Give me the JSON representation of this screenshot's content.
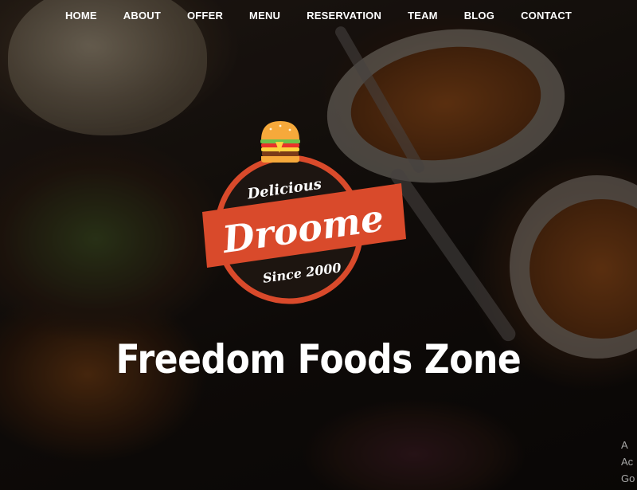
{
  "nav": {
    "items": [
      "HOME",
      "ABOUT",
      "OFFER",
      "MENU",
      "RESERVATION",
      "TEAM",
      "BLOG",
      "CONTACT"
    ]
  },
  "logo": {
    "tagline_top": "Delicious",
    "brand": "Droome",
    "tagline_bottom": "Since 2000",
    "icon": "burger-icon"
  },
  "hero": {
    "title": "Freedom Foods Zone"
  },
  "watermark": {
    "lines": [
      "A",
      "Ac",
      "Go"
    ]
  },
  "colors": {
    "accent": "#d94a2b",
    "ring_fill": "#1f1612",
    "text": "#ffffff"
  }
}
